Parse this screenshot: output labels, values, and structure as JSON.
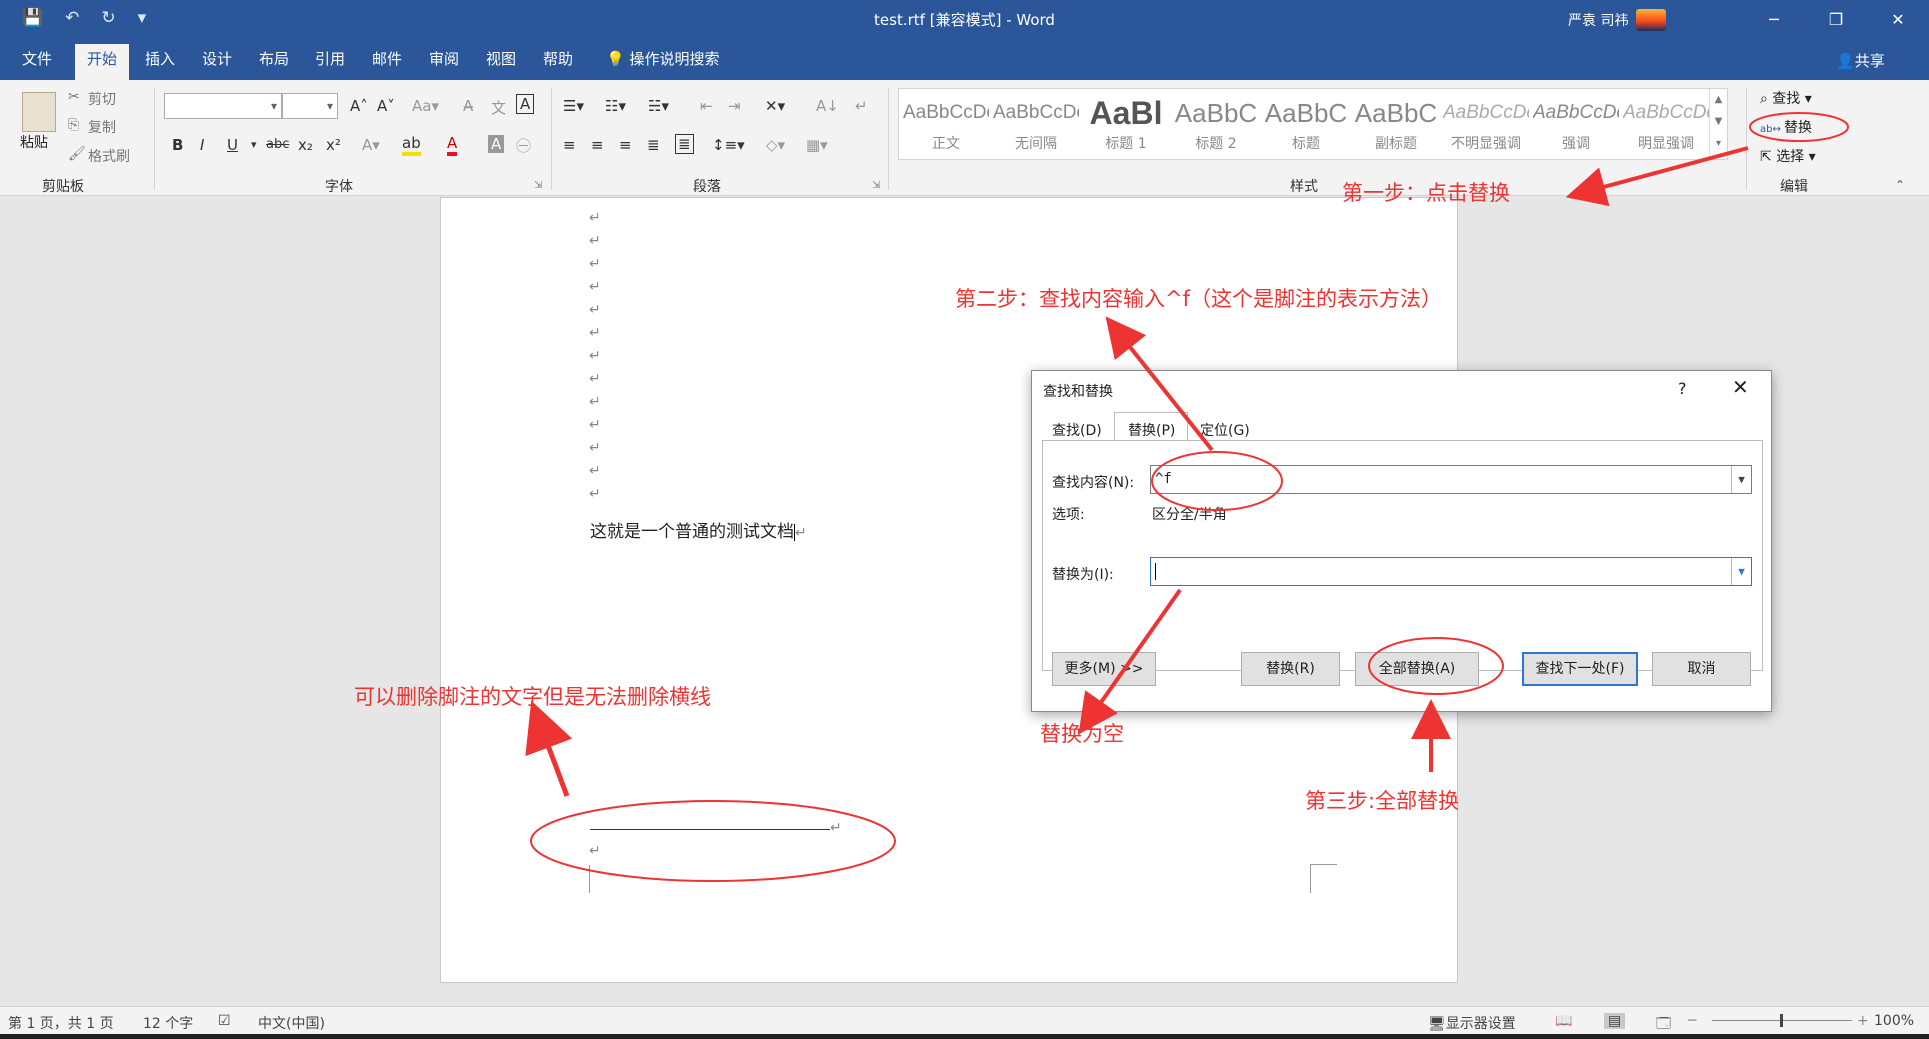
{
  "window": {
    "title": "test.rtf [兼容模式] - Word",
    "user": "严袁 司祎",
    "controls": [
      "─",
      "❐",
      "✕"
    ]
  },
  "qat": {
    "save_icon": "💾",
    "undo_icon": "↶",
    "redo_icon": "↻",
    "more_icon": "▾"
  },
  "tabs": {
    "file": "文件",
    "home": "开始",
    "insert": "插入",
    "design": "设计",
    "layout": "布局",
    "references": "引用",
    "mailings": "邮件",
    "review": "审阅",
    "view": "视图",
    "help": "帮助",
    "tell_me": "操作说明搜索",
    "share": "共享"
  },
  "ribbon": {
    "clipboard": {
      "paste": "粘贴",
      "cut": "剪切",
      "copy": "复制",
      "format_painter": "格式刷",
      "label": "剪贴板"
    },
    "font": {
      "label": "字体"
    },
    "paragraph": {
      "label": "段落"
    },
    "styles": {
      "label": "样式",
      "items": [
        {
          "sample": "AaBbCcDc",
          "name": "正文"
        },
        {
          "sample": "AaBbCcDc",
          "name": "无间隔"
        },
        {
          "sample": "AaBl",
          "name": "标题 1"
        },
        {
          "sample": "AaBbC",
          "name": "标题 2"
        },
        {
          "sample": "AaBbC",
          "name": "标题"
        },
        {
          "sample": "AaBbC",
          "name": "副标题"
        },
        {
          "sample": "AaBbCcDc",
          "name": "不明显强调"
        },
        {
          "sample": "AaBbCcDc",
          "name": "强调"
        },
        {
          "sample": "AaBbCcDc",
          "name": "明显强调"
        }
      ]
    },
    "editing": {
      "find": "查找",
      "replace": "替换",
      "select": "选择",
      "label": "编辑"
    }
  },
  "document": {
    "body_text": "这就是一个普通的测试文档",
    "paragraph_mark": "↵"
  },
  "dialog": {
    "title": "查找和替换",
    "help": "?",
    "close": "✕",
    "tabs": {
      "find": "查找(D)",
      "replace": "替换(P)",
      "goto": "定位(G)"
    },
    "find_label": "查找内容(N):",
    "find_value": "^f",
    "options_label": "选项:",
    "options_value": "区分全/半角",
    "replace_label": "替换为(I):",
    "replace_value": "",
    "buttons": {
      "more": "更多(M) >>",
      "replace": "替换(R)",
      "replace_all": "全部替换(A)",
      "find_next": "查找下一处(F)",
      "cancel": "取消"
    }
  },
  "statusbar": {
    "page": "第 1 页，共 1 页",
    "words": "12 个字",
    "language": "中文(中国)",
    "display_settings": "显示器设置",
    "zoom": "100%"
  },
  "annotations": {
    "step1": "第一步：点击替换",
    "step2": "第二步：查找内容输入^f（这个是脚注的表示方法）",
    "replace_empty": "替换为空",
    "step3": "第三步:全部替换",
    "note": "可以删除脚注的文字但是无法删除横线"
  },
  "colors": {
    "word_blue": "#2b579a",
    "annotation_red": "#ee3333",
    "focus_blue": "#2b78d4"
  }
}
